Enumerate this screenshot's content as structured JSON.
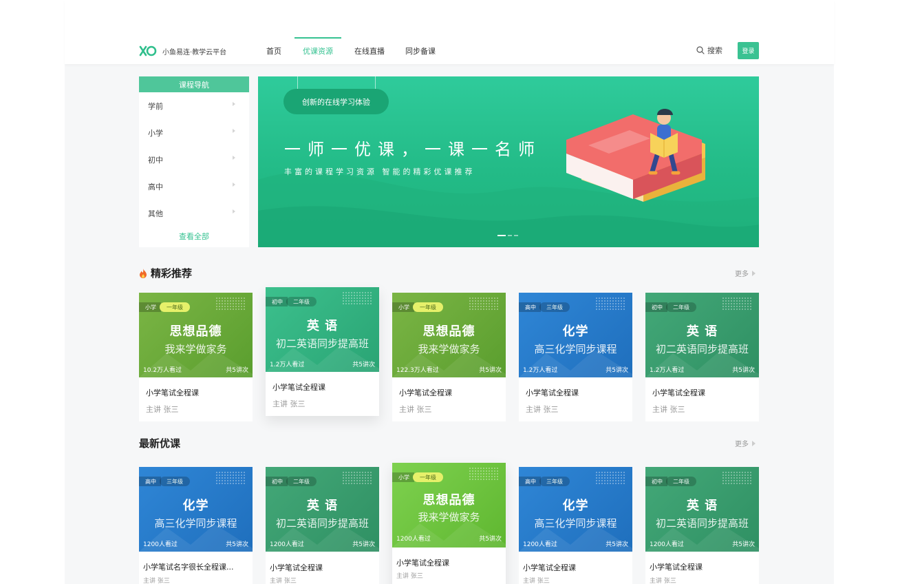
{
  "header": {
    "brand": "小鱼易连·教学云平台",
    "nav": [
      {
        "label": "首页",
        "active": false
      },
      {
        "label": "优课资源",
        "active": true
      },
      {
        "label": "在线直播",
        "active": false
      },
      {
        "label": "同步备课",
        "active": false
      }
    ],
    "search_label": "搜索",
    "login_label": "登录"
  },
  "course_nav": {
    "title": "课程导航",
    "items": [
      "学前",
      "小学",
      "初中",
      "高中",
      "其他"
    ],
    "view_all": "查看全部"
  },
  "banner": {
    "pill": "创新的在线学习体验",
    "headline": "一师一优课，一课一名师",
    "subline": "丰富的课程学习资源  智能的精彩优课推荐"
  },
  "sections": [
    {
      "title": "精彩推荐",
      "more": "更多",
      "cards": [
        {
          "level": "小学",
          "grade": "一年级",
          "title": "思想品德",
          "subtitle": "我来学做家务",
          "views": "10.2万人看过",
          "lessons": "共5讲次",
          "name": "小学笔试全程课",
          "teacher": "主讲  张三"
        },
        {
          "level": "初中",
          "grade": "二年级",
          "title": "英 语",
          "subtitle": "初二英语同步提高班",
          "views": "1.2万人看过",
          "lessons": "共5讲次",
          "name": "小学笔试全程课",
          "teacher": "主讲  张三"
        },
        {
          "level": "小学",
          "grade": "一年级",
          "title": "思想品德",
          "subtitle": "我来学做家务",
          "views": "122.3万人看过",
          "lessons": "共5讲次",
          "name": "小学笔试全程课",
          "teacher": "主讲  张三"
        },
        {
          "level": "高中",
          "grade": "三年级",
          "title": "化学",
          "subtitle": "高三化学同步课程",
          "views": "1.2万人看过",
          "lessons": "共5讲次",
          "name": "小学笔试全程课",
          "teacher": "主讲  张三"
        },
        {
          "level": "初中",
          "grade": "二年级",
          "title": "英 语",
          "subtitle": "初二英语同步提高班",
          "views": "1.2万人看过",
          "lessons": "共5讲次",
          "name": "小学笔试全程课",
          "teacher": "主讲  张三"
        }
      ]
    },
    {
      "title": "最新优课",
      "more": "更多",
      "cards": [
        {
          "level": "高中",
          "grade": "三年级",
          "title": "化学",
          "subtitle": "高三化学同步课程",
          "views": "1200人看过",
          "lessons": "共5讲次",
          "name": "小学笔试名字很长全程课...",
          "teacher": "主讲  张三"
        },
        {
          "level": "初中",
          "grade": "二年级",
          "title": "英 语",
          "subtitle": "初二英语同步提高班",
          "views": "1200人看过",
          "lessons": "共5讲次",
          "name": "小学笔试全程课",
          "teacher": "主讲  张三"
        },
        {
          "level": "小学",
          "grade": "一年级",
          "title": "思想品德",
          "subtitle": "我来学做家务",
          "views": "1200人看过",
          "lessons": "共5讲次",
          "name": "小学笔试全程课",
          "teacher": "主讲  张三"
        },
        {
          "level": "高中",
          "grade": "三年级",
          "title": "化学",
          "subtitle": "高三化学同步课程",
          "views": "1200人看过",
          "lessons": "共5讲次",
          "name": "小学笔试全程课",
          "teacher": "主讲  张三"
        },
        {
          "level": "初中",
          "grade": "二年级",
          "title": "英 语",
          "subtitle": "初二英语同步提高班",
          "views": "1200人看过",
          "lessons": "共5讲次",
          "name": "小学笔试全程课",
          "teacher": "主讲  张三"
        }
      ]
    }
  ],
  "colors": {
    "accent": "#35c291",
    "login": "#3ac292",
    "fire": "#f06a2a"
  },
  "icons": [
    "logo-icon",
    "search-icon",
    "fire-icon",
    "chevron-right-icon"
  ]
}
